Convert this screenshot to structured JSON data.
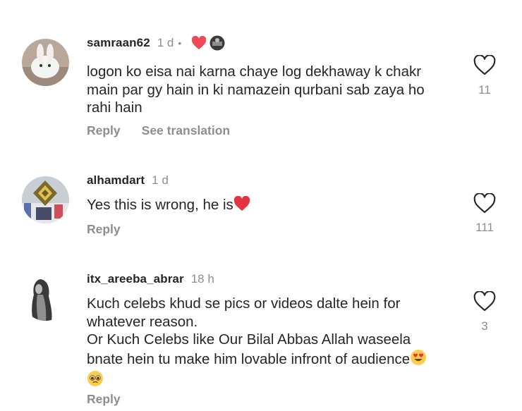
{
  "comments": [
    {
      "username": "samraan62",
      "time": "1 d",
      "separator": "•",
      "body_lines": [
        "logon ko eisa nai karna chaye log dekhaway k chakr",
        "main par gy hain  in ki namazein qurbani sab zaya ho",
        "rahi hain"
      ],
      "actions": [
        "Reply",
        "See translation"
      ],
      "likes": "11"
    },
    {
      "username": "alhamdart",
      "time": "1 d",
      "body_lines": [
        "Yes this is wrong, he is"
      ],
      "actions": [
        "Reply"
      ],
      "likes": "111"
    },
    {
      "username": "itx_areeba_abrar",
      "time": "18 h",
      "body_lines": [
        "Kuch celebs khud se pics or videos dalte hein for",
        "whatever reason.",
        "Or Kuch Celebs like Our Bilal Abbas Allah waseela",
        "bnate hein tu make him lovable infront of audience"
      ],
      "actions": [
        "Reply"
      ],
      "likes": "3"
    }
  ],
  "colors": {
    "text": "#262626",
    "muted": "#8e8e8e",
    "heart_red": "#ed4956",
    "emoji_yellow": "#ffcc4d"
  },
  "icons": {
    "like": "heart-outline-icon",
    "creator_liked": "red-heart-icon",
    "red_heart_emoji": "red-heart-emoji",
    "heart_eyes_emoji": "smiling-face-with-heart-eyes-emoji",
    "pleading_emoji": "pleading-face-emoji"
  }
}
